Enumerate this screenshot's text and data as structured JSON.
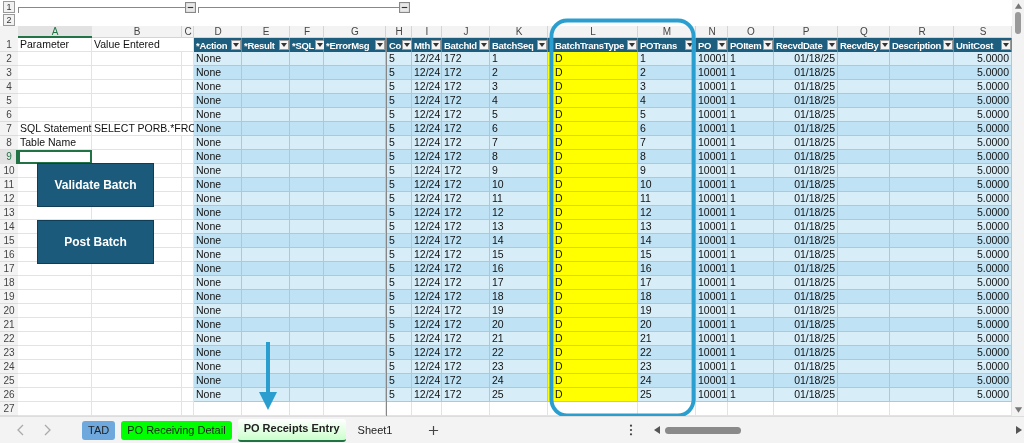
{
  "outline": {
    "levels": [
      "1",
      "2"
    ]
  },
  "columns": [
    {
      "letter": "A",
      "selected": true
    },
    {
      "letter": "B",
      "selected": false
    },
    {
      "letter": "C",
      "selected": false
    },
    {
      "letter": "D",
      "selected": false
    },
    {
      "letter": "E",
      "selected": false
    },
    {
      "letter": "F",
      "selected": false
    },
    {
      "letter": "G",
      "selected": false
    },
    {
      "letter": "H",
      "selected": false
    },
    {
      "letter": "I",
      "selected": false
    },
    {
      "letter": "J",
      "selected": false
    },
    {
      "letter": "K",
      "selected": false
    },
    {
      "letter": "L",
      "selected": false
    },
    {
      "letter": "M",
      "selected": false
    },
    {
      "letter": "N",
      "selected": false
    },
    {
      "letter": "O",
      "selected": false
    },
    {
      "letter": "P",
      "selected": false
    },
    {
      "letter": "Q",
      "selected": false
    },
    {
      "letter": "R",
      "selected": false
    },
    {
      "letter": "S",
      "selected": false
    }
  ],
  "row_numbers": [
    {
      "label": "1",
      "selected": false
    },
    {
      "label": "2",
      "selected": false
    },
    {
      "label": "3",
      "selected": false
    },
    {
      "label": "4",
      "selected": false
    },
    {
      "label": "5",
      "selected": false
    },
    {
      "label": "6",
      "selected": false
    },
    {
      "label": "7",
      "selected": false
    },
    {
      "label": "8",
      "selected": false
    },
    {
      "label": "9",
      "selected": true
    },
    {
      "label": "10",
      "selected": false
    },
    {
      "label": "11",
      "selected": false
    },
    {
      "label": "12",
      "selected": false
    },
    {
      "label": "13",
      "selected": false
    },
    {
      "label": "14",
      "selected": false
    },
    {
      "label": "15",
      "selected": false
    },
    {
      "label": "16",
      "selected": false
    },
    {
      "label": "17",
      "selected": false
    },
    {
      "label": "18",
      "selected": false
    },
    {
      "label": "19",
      "selected": false
    },
    {
      "label": "20",
      "selected": false
    },
    {
      "label": "21",
      "selected": false
    },
    {
      "label": "22",
      "selected": false
    },
    {
      "label": "23",
      "selected": false
    },
    {
      "label": "24",
      "selected": false
    },
    {
      "label": "25",
      "selected": false
    },
    {
      "label": "26",
      "selected": false
    },
    {
      "label": "27",
      "selected": false
    }
  ],
  "parameters": [
    {
      "label": "Parameter",
      "value": "Value Entered"
    },
    {
      "label": "SQL Statement",
      "value": "SELECT PORB.*FRO"
    },
    {
      "label": "Table Name"
    }
  ],
  "table": {
    "headers": [
      "*Action",
      "*Result",
      "*SQL",
      "*ErrorMsg",
      "Co",
      "Mth",
      "BatchId",
      "BatchSeq",
      "BatchTransType",
      "POTrans",
      "PO",
      "POItem",
      "RecvdDate",
      "RecvdBy",
      "Description",
      "UnitCost"
    ],
    "rows": [
      {
        "action": "None",
        "co": "5",
        "mth": "12/24",
        "batch_id": "172",
        "batch_seq": "1",
        "batch_trans_type": "D",
        "po_trans": "1",
        "po": "10001",
        "po_item": "1",
        "recvd_date": "01/18/25",
        "unit_cost": "5.0000"
      },
      {
        "action": "None",
        "co": "5",
        "mth": "12/24",
        "batch_id": "172",
        "batch_seq": "2",
        "batch_trans_type": "D",
        "po_trans": "2",
        "po": "10001",
        "po_item": "1",
        "recvd_date": "01/18/25",
        "unit_cost": "5.0000"
      },
      {
        "action": "None",
        "co": "5",
        "mth": "12/24",
        "batch_id": "172",
        "batch_seq": "3",
        "batch_trans_type": "D",
        "po_trans": "3",
        "po": "10001",
        "po_item": "1",
        "recvd_date": "01/18/25",
        "unit_cost": "5.0000"
      },
      {
        "action": "None",
        "co": "5",
        "mth": "12/24",
        "batch_id": "172",
        "batch_seq": "4",
        "batch_trans_type": "D",
        "po_trans": "4",
        "po": "10001",
        "po_item": "1",
        "recvd_date": "01/18/25",
        "unit_cost": "5.0000"
      },
      {
        "action": "None",
        "co": "5",
        "mth": "12/24",
        "batch_id": "172",
        "batch_seq": "5",
        "batch_trans_type": "D",
        "po_trans": "5",
        "po": "10001",
        "po_item": "1",
        "recvd_date": "01/18/25",
        "unit_cost": "5.0000"
      },
      {
        "action": "None",
        "co": "5",
        "mth": "12/24",
        "batch_id": "172",
        "batch_seq": "6",
        "batch_trans_type": "D",
        "po_trans": "6",
        "po": "10001",
        "po_item": "1",
        "recvd_date": "01/18/25",
        "unit_cost": "5.0000"
      },
      {
        "action": "None",
        "co": "5",
        "mth": "12/24",
        "batch_id": "172",
        "batch_seq": "7",
        "batch_trans_type": "D",
        "po_trans": "7",
        "po": "10001",
        "po_item": "1",
        "recvd_date": "01/18/25",
        "unit_cost": "5.0000"
      },
      {
        "action": "None",
        "co": "5",
        "mth": "12/24",
        "batch_id": "172",
        "batch_seq": "8",
        "batch_trans_type": "D",
        "po_trans": "8",
        "po": "10001",
        "po_item": "1",
        "recvd_date": "01/18/25",
        "unit_cost": "5.0000"
      },
      {
        "action": "None",
        "co": "5",
        "mth": "12/24",
        "batch_id": "172",
        "batch_seq": "9",
        "batch_trans_type": "D",
        "po_trans": "9",
        "po": "10001",
        "po_item": "1",
        "recvd_date": "01/18/25",
        "unit_cost": "5.0000"
      },
      {
        "action": "None",
        "co": "5",
        "mth": "12/24",
        "batch_id": "172",
        "batch_seq": "10",
        "batch_trans_type": "D",
        "po_trans": "10",
        "po": "10001",
        "po_item": "1",
        "recvd_date": "01/18/25",
        "unit_cost": "5.0000"
      },
      {
        "action": "None",
        "co": "5",
        "mth": "12/24",
        "batch_id": "172",
        "batch_seq": "11",
        "batch_trans_type": "D",
        "po_trans": "11",
        "po": "10001",
        "po_item": "1",
        "recvd_date": "01/18/25",
        "unit_cost": "5.0000"
      },
      {
        "action": "None",
        "co": "5",
        "mth": "12/24",
        "batch_id": "172",
        "batch_seq": "12",
        "batch_trans_type": "D",
        "po_trans": "12",
        "po": "10001",
        "po_item": "1",
        "recvd_date": "01/18/25",
        "unit_cost": "5.0000"
      },
      {
        "action": "None",
        "co": "5",
        "mth": "12/24",
        "batch_id": "172",
        "batch_seq": "13",
        "batch_trans_type": "D",
        "po_trans": "13",
        "po": "10001",
        "po_item": "1",
        "recvd_date": "01/18/25",
        "unit_cost": "5.0000"
      },
      {
        "action": "None",
        "co": "5",
        "mth": "12/24",
        "batch_id": "172",
        "batch_seq": "14",
        "batch_trans_type": "D",
        "po_trans": "14",
        "po": "10001",
        "po_item": "1",
        "recvd_date": "01/18/25",
        "unit_cost": "5.0000"
      },
      {
        "action": "None",
        "co": "5",
        "mth": "12/24",
        "batch_id": "172",
        "batch_seq": "15",
        "batch_trans_type": "D",
        "po_trans": "15",
        "po": "10001",
        "po_item": "1",
        "recvd_date": "01/18/25",
        "unit_cost": "5.0000"
      },
      {
        "action": "None",
        "co": "5",
        "mth": "12/24",
        "batch_id": "172",
        "batch_seq": "16",
        "batch_trans_type": "D",
        "po_trans": "16",
        "po": "10001",
        "po_item": "1",
        "recvd_date": "01/18/25",
        "unit_cost": "5.0000"
      },
      {
        "action": "None",
        "co": "5",
        "mth": "12/24",
        "batch_id": "172",
        "batch_seq": "17",
        "batch_trans_type": "D",
        "po_trans": "17",
        "po": "10001",
        "po_item": "1",
        "recvd_date": "01/18/25",
        "unit_cost": "5.0000"
      },
      {
        "action": "None",
        "co": "5",
        "mth": "12/24",
        "batch_id": "172",
        "batch_seq": "18",
        "batch_trans_type": "D",
        "po_trans": "18",
        "po": "10001",
        "po_item": "1",
        "recvd_date": "01/18/25",
        "unit_cost": "5.0000"
      },
      {
        "action": "None",
        "co": "5",
        "mth": "12/24",
        "batch_id": "172",
        "batch_seq": "19",
        "batch_trans_type": "D",
        "po_trans": "19",
        "po": "10001",
        "po_item": "1",
        "recvd_date": "01/18/25",
        "unit_cost": "5.0000"
      },
      {
        "action": "None",
        "co": "5",
        "mth": "12/24",
        "batch_id": "172",
        "batch_seq": "20",
        "batch_trans_type": "D",
        "po_trans": "20",
        "po": "10001",
        "po_item": "1",
        "recvd_date": "01/18/25",
        "unit_cost": "5.0000"
      },
      {
        "action": "None",
        "co": "5",
        "mth": "12/24",
        "batch_id": "172",
        "batch_seq": "21",
        "batch_trans_type": "D",
        "po_trans": "21",
        "po": "10001",
        "po_item": "1",
        "recvd_date": "01/18/25",
        "unit_cost": "5.0000"
      },
      {
        "action": "None",
        "co": "5",
        "mth": "12/24",
        "batch_id": "172",
        "batch_seq": "22",
        "batch_trans_type": "D",
        "po_trans": "22",
        "po": "10001",
        "po_item": "1",
        "recvd_date": "01/18/25",
        "unit_cost": "5.0000"
      },
      {
        "action": "None",
        "co": "5",
        "mth": "12/24",
        "batch_id": "172",
        "batch_seq": "23",
        "batch_trans_type": "D",
        "po_trans": "23",
        "po": "10001",
        "po_item": "1",
        "recvd_date": "01/18/25",
        "unit_cost": "5.0000"
      },
      {
        "action": "None",
        "co": "5",
        "mth": "12/24",
        "batch_id": "172",
        "batch_seq": "24",
        "batch_trans_type": "D",
        "po_trans": "24",
        "po": "10001",
        "po_item": "1",
        "recvd_date": "01/18/25",
        "unit_cost": "5.0000"
      },
      {
        "action": "None",
        "co": "5",
        "mth": "12/24",
        "batch_id": "172",
        "batch_seq": "25",
        "batch_trans_type": "D",
        "po_trans": "25",
        "po": "10001",
        "po_item": "1",
        "recvd_date": "01/18/25",
        "unit_cost": "5.0000"
      }
    ]
  },
  "buttons": [
    {
      "label": "Validate Batch"
    },
    {
      "label": "Post Batch"
    }
  ],
  "sheet_tabs": [
    {
      "label": "TAD",
      "selected": false,
      "color": "#6fa8dc"
    },
    {
      "label": "PO Receiving Detail",
      "selected": false,
      "color": "#00ff00"
    },
    {
      "label": "PO Receipts Entry",
      "selected": true,
      "color": "#ccffcc"
    },
    {
      "label": "Sheet1",
      "selected": false
    }
  ]
}
